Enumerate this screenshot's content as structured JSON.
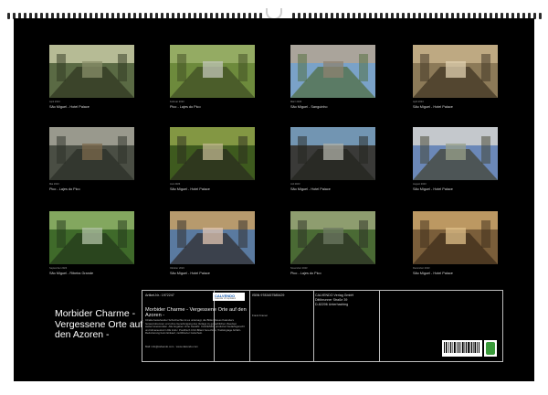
{
  "calendar": {
    "title": "Morbider Charme - Vergessene Orte auf den Azoren -",
    "photos": [
      {
        "caption": "São Miguel - Hotel Palace",
        "credit": "April 2023"
      },
      {
        "caption": "Pico - Lajes do Pico",
        "credit": "Februar 2023"
      },
      {
        "caption": "São Miguel - Sanguinho",
        "credit": "März 2023"
      },
      {
        "caption": "São Miguel - Hotel Palace",
        "credit": "April 2023"
      },
      {
        "caption": "Pico - Lajes do Pico",
        "credit": "Mai 2023"
      },
      {
        "caption": "São Miguel - Hotel Palace",
        "credit": "Juni 2023"
      },
      {
        "caption": "São Miguel - Hotel Palace",
        "credit": "Juli 2023"
      },
      {
        "caption": "São Miguel - Hotel Palace",
        "credit": "August 2023"
      },
      {
        "caption": "São Miguel - Ribeira Grande",
        "credit": "September 2023"
      },
      {
        "caption": "São Miguel - Hotel Palace",
        "credit": "Oktober 2023"
      },
      {
        "caption": "Pico - Lajes do Pico",
        "credit": "November 2023"
      },
      {
        "caption": "São Miguel - Hotel Palace",
        "credit": "Dezember 2023"
      }
    ]
  },
  "info": {
    "article_no": "Artikel-Nr.: 1972247",
    "isbn": "ISBN 9783457585429",
    "publisher_lines": [
      "CALVENDO Verlag GmbH",
      "Dittibrunner Straße 39",
      "D-82206 Unterhaching"
    ],
    "product_title": "Morbider Charme - Vergessene Orte auf den Azoren -",
    "author": "Frank Kramer",
    "legal_text": "Inhalte bestehender Schutzrechte ist es untersagt, die Bilder dieses Kalenders herauszutrennen und ohne Genehmigung des Verlags zu gewerblichen Zwecken weiterzuverwenden. Alle Angaben ohne Gewähr. CALVENDO produziert bedarfsgerecht und klimaneutral in DE & EU. Postfrisch CO2-Bilanz berechnet, Trekkingtage Airfaht-Reduzierung beim Einkauf, zertifizierter Gutschein.",
    "contact": "Mail: info@calvendo.com · www.calvendo.com",
    "logo_name": "CALVENDO",
    "logo_tagline": "Calendar of Inspiration"
  }
}
